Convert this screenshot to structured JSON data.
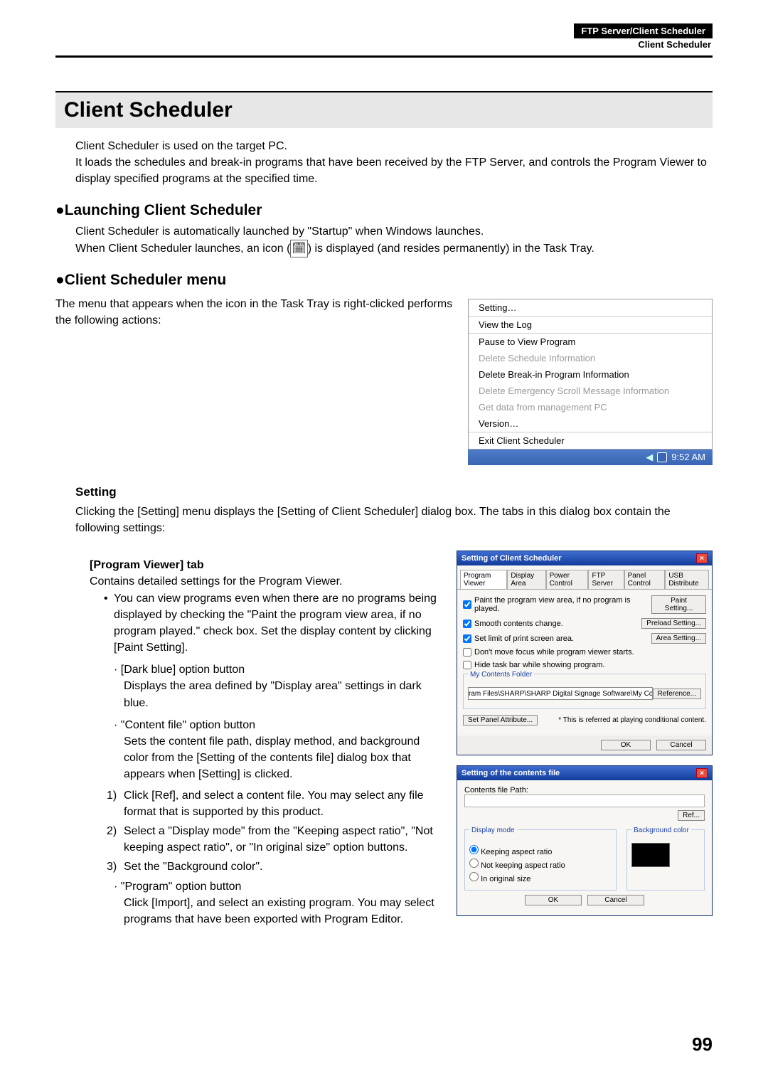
{
  "header": {
    "chapter": "FTP Server/Client Scheduler",
    "section": "Client Scheduler"
  },
  "page_number": "99",
  "title": "Client Scheduler",
  "intro1": "Client Scheduler is used on the target PC.",
  "intro2": "It loads the schedules and break-in programs that have been received by the FTP Server, and controls the Program Viewer to display specified programs at the specified time.",
  "h2a": "Launching Client Scheduler",
  "launch1": "Client Scheduler is automatically launched by \"Startup\" when Windows launches.",
  "launch2a": "When Client Scheduler launches, an icon (",
  "launch2b": ") is displayed (and resides permanently) in the Task Tray.",
  "h2b": "Client Scheduler menu",
  "menu_desc": "The menu that appears when the icon in the Task Tray is right-clicked performs the following actions:",
  "ctx": {
    "m0": "Setting…",
    "m1": "View the Log",
    "m2": "Pause to View Program",
    "m3": "Delete Schedule Information",
    "m4": "Delete Break-in Program Information",
    "m5": "Delete Emergency Scroll Message Information",
    "m6": "Get data from management PC",
    "m7": "Version…",
    "m8": "Exit Client Scheduler"
  },
  "tray_time": "9:52 AM",
  "h3_setting": "Setting",
  "setting_desc": "Clicking the [Setting] menu displays the [Setting of Client Scheduler] dialog box. The tabs in this dialog box contain the following settings:",
  "h4_pv": "[Program Viewer] tab",
  "pv_desc": "Contains detailed settings for the Program Viewer.",
  "b1": "You can view programs even when there are no programs being displayed by checking the \"Paint the program view area, if no program played.\" check box. Set the display content by clicking [Paint Setting].",
  "db_h": "· [Dark blue] option button",
  "db_t": "Displays the area defined by \"Display area\" settings in dark blue.",
  "cf_h": "· \"Content file\" option button",
  "cf_t": "Sets the content file path, display method, and background color from the [Setting of the contents file] dialog box that appears when [Setting] is clicked.",
  "ol1": "Click [Ref], and select a content file. You may select any file format that is supported by this product.",
  "ol2": "Select a \"Display mode\" from the \"Keeping aspect ratio\", \"Not keeping aspect ratio\", or \"In original size\" option buttons.",
  "ol3": "Set the \"Background color\".",
  "pg_h": "· \"Program\" option button",
  "pg_t": "Click [Import], and select an existing program. You may select programs that have been exported with Program Editor.",
  "dlg1": {
    "title": "Setting of Client Scheduler",
    "tabs": {
      "t0": "Program Viewer",
      "t1": "Display Area",
      "t2": "Power Control",
      "t3": "FTP Server",
      "t4": "Panel Control",
      "t5": "USB Distribute"
    },
    "c1": "Paint the program view area, if no program is played.",
    "b1": "Paint Setting...",
    "c2": "Smooth contents change.",
    "b2": "Preload Setting...",
    "c3": "Set limit of print screen area.",
    "b3": "Area Setting...",
    "c4": "Don't move focus while program viewer starts.",
    "c5": "Hide task bar while showing program.",
    "grp": "My Contents Folder",
    "path": "ram Files\\SHARP\\SHARP Digital Signage Software\\My Contents\\",
    "ref": "Reference...",
    "attr": "Set Panel Attribute...",
    "note": "* This is referred at playing conditional content.",
    "ok": "OK",
    "cancel": "Cancel"
  },
  "dlg2": {
    "title": "Setting of the contents file",
    "pathlbl": "Contents file Path:",
    "ref": "Ref...",
    "dm": "Display mode",
    "r1": "Keeping aspect ratio",
    "r2": "Not keeping aspect ratio",
    "r3": "In original size",
    "bg": "Background color",
    "ok": "OK",
    "cancel": "Cancel"
  }
}
